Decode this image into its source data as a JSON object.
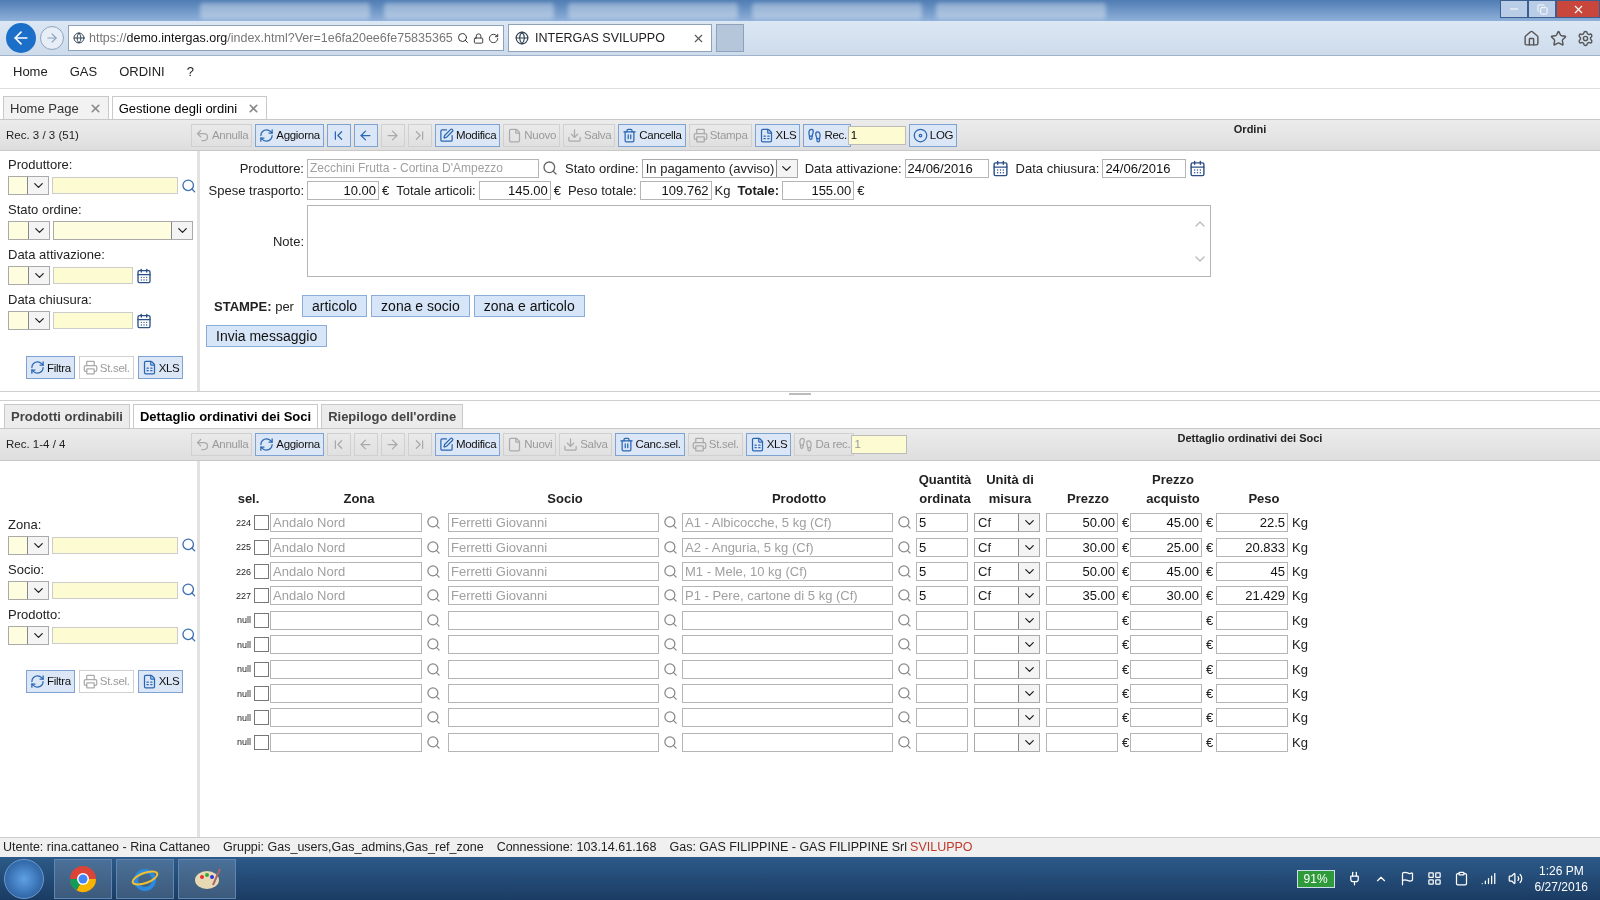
{
  "browser": {
    "url": {
      "scheme": "https://",
      "host": "demo.intergas.org",
      "path": "/index.html?Ver=1e6fa20ee6fe75835365"
    },
    "tab_title": "INTERGAS SVILUPPO"
  },
  "menu": [
    "Home",
    "GAS",
    "ORDINI",
    "?"
  ],
  "tabs": [
    {
      "label": "Home Page",
      "selected": false
    },
    {
      "label": "Gestione degli ordini",
      "selected": true
    }
  ],
  "toolbar": {
    "record": "Rec. 3 / 3 (51)",
    "title": "Ordini",
    "items": [
      {
        "kind": "undo",
        "label": "Annulla",
        "disabled": true
      },
      {
        "kind": "refresh",
        "label": "Aggiorna",
        "disabled": false
      },
      {
        "kind": "first",
        "disabled": false
      },
      {
        "kind": "prev",
        "disabled": false
      },
      {
        "kind": "next",
        "disabled": true
      },
      {
        "kind": "last",
        "disabled": true
      },
      {
        "kind": "edit",
        "label": "Modifica",
        "disabled": false
      },
      {
        "kind": "new",
        "label": "Nuovo",
        "disabled": true
      },
      {
        "kind": "save",
        "label": "Salva",
        "disabled": true
      },
      {
        "kind": "delete",
        "label": "Cancella",
        "disabled": false
      },
      {
        "kind": "print",
        "label": "Stampa",
        "disabled": true
      },
      {
        "kind": "export",
        "label": "XLS",
        "disabled": false
      },
      {
        "kind": "record",
        "label": "Rec.",
        "value": "1",
        "disabled": false
      },
      {
        "kind": "log",
        "label": "LOG",
        "disabled": false
      }
    ]
  },
  "order_filters": {
    "fields": [
      {
        "kind": "lookup",
        "label": "Produttore:"
      },
      {
        "kind": "select",
        "label": "Stato ordine:"
      },
      {
        "kind": "date",
        "label": "Data attivazione:"
      },
      {
        "kind": "date",
        "label": "Data chiusura:"
      }
    ],
    "buttons": [
      {
        "kind": "refresh",
        "label": "Filtra",
        "disabled": false
      },
      {
        "kind": "print",
        "label": "St.sel.",
        "disabled": true
      },
      {
        "kind": "export",
        "label": "XLS",
        "disabled": false
      }
    ]
  },
  "order": {
    "header_fields": [
      {
        "kind": "lookup",
        "label": "Produttore:",
        "value": "Zecchini Frutta - Cortina D'Ampezzo"
      },
      {
        "kind": "select",
        "label": "Stato ordine:",
        "value": "In pagamento (avviso)"
      },
      {
        "kind": "date",
        "label": "Data attivazione:",
        "value": "24/06/2016"
      },
      {
        "kind": "date",
        "label": "Data chiusura:",
        "value": "24/06/2016"
      }
    ],
    "totals": [
      {
        "label": "Spese trasporto:",
        "value": "10.00",
        "unit": "€",
        "strong": false
      },
      {
        "label": "Totale articoli:",
        "value": "145.00",
        "unit": "€",
        "strong": false
      },
      {
        "label": "Peso totale:",
        "value": "109.762",
        "unit": "Kg",
        "strong": false
      },
      {
        "label": "Totale:",
        "value": "155.00",
        "unit": "€",
        "strong": true
      }
    ],
    "note_label": "Note:",
    "prints_label": "**STAMPE:** per",
    "print_buttons": [
      "articolo",
      "zona e socio",
      "zona e articolo"
    ],
    "message_button": "Invia messaggio"
  },
  "detail_tabs": [
    {
      "label": "Prodotti ordinabili",
      "selected": false
    },
    {
      "label": "Dettaglio ordinativi dei Soci",
      "selected": true
    },
    {
      "label": "Riepilogo dell'ordine",
      "selected": false
    }
  ],
  "detail_toolbar": {
    "record": "Rec. 1-4 / 4",
    "title": "Dettaglio ordinativi dei Soci",
    "items": [
      {
        "kind": "undo",
        "label": "Annulla",
        "disabled": true
      },
      {
        "kind": "refresh",
        "label": "Aggiorna",
        "disabled": false
      },
      {
        "kind": "first",
        "disabled": true
      },
      {
        "kind": "prev",
        "disabled": true
      },
      {
        "kind": "next",
        "disabled": true
      },
      {
        "kind": "last",
        "disabled": true
      },
      {
        "kind": "edit",
        "label": "Modifica",
        "disabled": false
      },
      {
        "kind": "new",
        "label": "Nuovi",
        "disabled": true
      },
      {
        "kind": "save",
        "label": "Salva",
        "disabled": true
      },
      {
        "kind": "delete",
        "label": "Canc.sel.",
        "disabled": false
      },
      {
        "kind": "print",
        "label": "St.sel.",
        "disabled": true
      },
      {
        "kind": "export",
        "label": "XLS",
        "disabled": false
      },
      {
        "kind": "record",
        "label": "Da rec.",
        "value": "1",
        "disabled": true
      }
    ]
  },
  "detail_filters": {
    "fields": [
      {
        "kind": "lookup",
        "label": "Zona:"
      },
      {
        "kind": "lookup",
        "label": "Socio:"
      },
      {
        "kind": "lookup",
        "label": "Prodotto:"
      }
    ],
    "buttons": [
      {
        "kind": "refresh",
        "label": "Filtra",
        "disabled": false
      },
      {
        "kind": "print",
        "label": "St.sel.",
        "disabled": true
      },
      {
        "kind": "export",
        "label": "XLS",
        "disabled": false
      }
    ]
  },
  "table": {
    "columns": [
      "sel.",
      "Zona",
      "Socio",
      "Prodotto",
      "Quantità ordinata",
      "Unità di misura",
      "Prezzo",
      "Prezzo acquisto",
      "Peso"
    ],
    "rows": [
      {
        "row_label": "224",
        "checked": false,
        "zona": "Andalo Nord",
        "socio": "Ferretti Giovanni",
        "prodotto": "A1 - Albicocche, 5 kg (Cf)",
        "quantita": "5",
        "unita": "Cf",
        "prezzo": "50.00",
        "prezzo_unit": "€",
        "acquisto": "45.00",
        "acquisto_unit": "€",
        "peso": "22.5",
        "peso_unit": "Kg"
      },
      {
        "row_label": "225",
        "checked": false,
        "zona": "Andalo Nord",
        "socio": "Ferretti Giovanni",
        "prodotto": "A2 - Anguria, 5 kg (Cf)",
        "quantita": "5",
        "unita": "Cf",
        "prezzo": "30.00",
        "prezzo_unit": "€",
        "acquisto": "25.00",
        "acquisto_unit": "€",
        "peso": "20.833",
        "peso_unit": "Kg"
      },
      {
        "row_label": "226",
        "checked": false,
        "zona": "Andalo Nord",
        "socio": "Ferretti Giovanni",
        "prodotto": "M1 - Mele, 10 kg (Cf)",
        "quantita": "5",
        "unita": "Cf",
        "prezzo": "50.00",
        "prezzo_unit": "€",
        "acquisto": "45.00",
        "acquisto_unit": "€",
        "peso": "45",
        "peso_unit": "Kg"
      },
      {
        "row_label": "227",
        "checked": false,
        "zona": "Andalo Nord",
        "socio": "Ferretti Giovanni",
        "prodotto": "P1 - Pere, cartone di 5 kg (Cf)",
        "quantita": "5",
        "unita": "Cf",
        "prezzo": "35.00",
        "prezzo_unit": "€",
        "acquisto": "30.00",
        "acquisto_unit": "€",
        "peso": "21.429",
        "peso_unit": "Kg"
      },
      {
        "row_label": "null",
        "checked": false,
        "prezzo_unit": "€",
        "acquisto_unit": "€",
        "peso_unit": "Kg"
      },
      {
        "row_label": "null",
        "checked": false,
        "prezzo_unit": "€",
        "acquisto_unit": "€",
        "peso_unit": "Kg"
      },
      {
        "row_label": "null",
        "checked": false,
        "prezzo_unit": "€",
        "acquisto_unit": "€",
        "peso_unit": "Kg"
      },
      {
        "row_label": "null",
        "checked": false,
        "prezzo_unit": "€",
        "acquisto_unit": "€",
        "peso_unit": "Kg"
      },
      {
        "row_label": "null",
        "checked": false,
        "prezzo_unit": "€",
        "acquisto_unit": "€",
        "peso_unit": "Kg"
      },
      {
        "row_label": "null",
        "checked": false,
        "prezzo_unit": "€",
        "acquisto_unit": "€",
        "peso_unit": "Kg"
      }
    ]
  },
  "status_bar": [
    {
      "kind": "info",
      "text": "Utente: rina.cattaneo - Rina Cattaneo"
    },
    {
      "kind": "info",
      "text": "Gruppi: Gas_users,Gas_admins,Gas_ref_zone"
    },
    {
      "kind": "info",
      "text": "Connessione: 103.14.61.168"
    },
    {
      "kind": "info",
      "text": "Gas: GAS FILIPPINE - GAS FILIPPINE Srl"
    },
    {
      "kind": "env",
      "text": "SVILUPPO"
    }
  ],
  "taskbar": {
    "battery": "91%",
    "time": "1:26 PM",
    "date": "6/27/2016"
  }
}
